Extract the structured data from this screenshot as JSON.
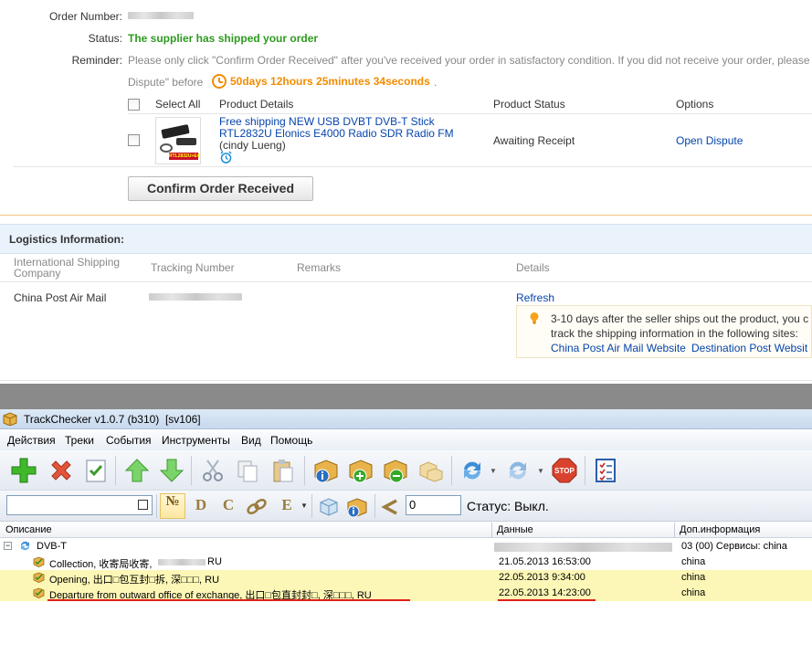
{
  "order": {
    "number_label": "Order Number:",
    "status_label": "Status:",
    "status_value": "The supplier has shipped your order",
    "reminder_label": "Reminder:",
    "reminder_text": "Please only click \"Confirm Order Received\" after you've received your order in satisfactory condition. If you did not receive your order, please",
    "reminder_text2": "Dispute\" before",
    "countdown": "50days 12hours 25minutes 34seconds",
    "countdown_tail": ".",
    "table_headers": [
      "Select All",
      "Product Details",
      "Product Status",
      "Options"
    ],
    "product": {
      "title": "Free shipping NEW USB DVBT DVB-T Stick RTL2832U Elonics E4000 Radio SDR Radio FM",
      "seller": "(cindy Lueng)",
      "thumb_text": "RTL2832U+E4000",
      "status": "Awaiting Receipt",
      "option": "Open Dispute"
    },
    "confirm_button": "Confirm Order Received"
  },
  "logistics": {
    "heading": "Logistics Information:",
    "headers": [
      "International Shipping Company",
      "Tracking Number",
      "Remarks",
      "Details"
    ],
    "company": "China Post Air Mail",
    "refresh": "Refresh",
    "tip_line1": "3-10 days after the seller ships out the product, you c",
    "tip_line2": "track the shipping information in the following sites:",
    "tip_link1": "China Post Air Mail Website",
    "tip_link2": "Destination Post Websit"
  },
  "trackchecker": {
    "title": "TrackChecker v1.0.7 (b310)  [sv106]",
    "menu": [
      "Действия",
      "Треки",
      "События",
      "Инструменты",
      "Вид",
      "Помощь"
    ],
    "filter_letters": [
      "№",
      "D",
      "C",
      "",
      "E"
    ],
    "counter_value": "0",
    "status_text": "Статус: Выкл.",
    "columns": [
      "Описание",
      "Данные",
      "Доп.информация"
    ],
    "group": {
      "name": "DVB-T",
      "info": "03 (00) Сервисы: china"
    },
    "rows": [
      {
        "desc": "Collection, 收寄局收寄, ",
        "desc_tail": " RU",
        "date": "21.05.2013 16:53:00",
        "info": "china"
      },
      {
        "desc": "Opening, 出口□包互封□拆, 深□□□, RU",
        "desc_tail": "",
        "date": "22.05.2013 9:34:00",
        "info": "china"
      },
      {
        "desc": "Departure from outward office of exchange, 出口□包直封封□, 深□□□, RU",
        "desc_tail": "",
        "date": "22.05.2013 14:23:00",
        "info": "china"
      }
    ]
  },
  "colors": {
    "status_green": "#2e9a1f",
    "countdown_orange": "#f28c00",
    "link_blue": "#0645ad",
    "highlight_row": "#fcf7b6",
    "underline_red": "#e0201b"
  }
}
